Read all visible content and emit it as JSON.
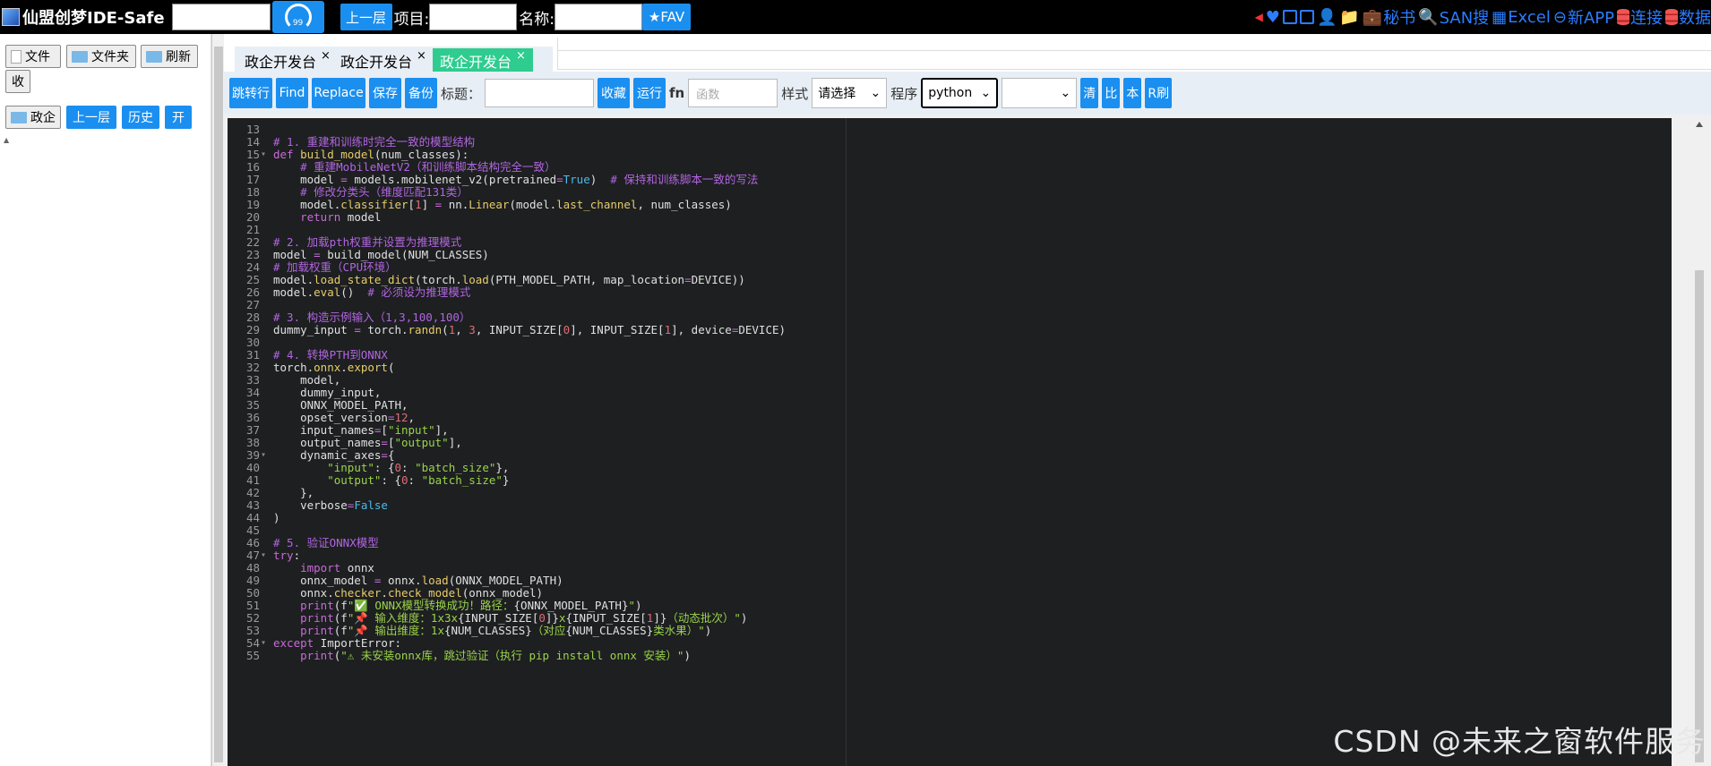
{
  "topbar": {
    "app_title": "仙盟创梦IDE-Safe",
    "up_label": "上一层",
    "project_label": "项目:",
    "name_label": "名称:",
    "fav_label": "★FAV",
    "gauge_value": "99",
    "right_menu": {
      "secret_book": "秘书",
      "san_search": "SAN搜",
      "excel": "Excel",
      "new_app": "新APP",
      "connect": "连接",
      "data": "数据"
    }
  },
  "left": {
    "file_btn": "文件",
    "folder_btn": "文件夹",
    "refresh_btn": "刷新",
    "collapse_btn": "收",
    "gov_btn": "政企",
    "up_btn": "上一层",
    "history_btn": "历史",
    "open_btn": "开"
  },
  "tabs": [
    {
      "label": "政企开发台",
      "active": false
    },
    {
      "label": "政企开发台",
      "active": false
    },
    {
      "label": "政企开发台",
      "active": true
    }
  ],
  "toolbar": {
    "goto_line": "跳转行",
    "find": "Find",
    "replace": "Replace",
    "save": "保存",
    "backup": "备份",
    "title_label": "标题：",
    "favorite": "收藏",
    "run": "运行",
    "fn_label": "fn",
    "fn_placeholder": "函数",
    "style_label": "样式",
    "style_select": "请选择",
    "program_label": "程序",
    "program_select": "python",
    "clear": "清",
    "compare": "比",
    "local": "本",
    "r_refresh": "R刷"
  },
  "editor": {
    "lines": [
      {
        "n": "13",
        "fold": false,
        "html": ""
      },
      {
        "n": "14",
        "fold": false,
        "html": "<span class='c'># 1. 重建和训练时完全一致的模型结构</span>"
      },
      {
        "n": "15",
        "fold": true,
        "html": "<span class='k'>def</span> <span class='fn'>build_model</span>(num_classes):"
      },
      {
        "n": "16",
        "fold": false,
        "html": "    <span class='c'># 重建MobileNetV2（和训练脚本结构完全一致）</span>"
      },
      {
        "n": "17",
        "fold": false,
        "html": "    model <span class='op'>=</span> models.mobilenet_v2(pretrained<span class='op'>=</span><span class='b'>True</span>)  <span class='c'># 保持和训练脚本一致的写法</span>"
      },
      {
        "n": "18",
        "fold": false,
        "html": "    <span class='c'># 修改分类头（维度匹配131类）</span>"
      },
      {
        "n": "19",
        "fold": false,
        "html": "    model.<span class='fn'>classifier</span>[<span class='n'>1</span>] <span class='op'>=</span> nn.<span class='fn'>Linear</span>(model.<span class='fn'>last_channel</span>, num_classes)"
      },
      {
        "n": "20",
        "fold": false,
        "html": "    <span class='k'>return</span> model"
      },
      {
        "n": "21",
        "fold": false,
        "html": ""
      },
      {
        "n": "22",
        "fold": false,
        "html": "<span class='c'># 2. 加载pth权重并设置为推理模式</span>"
      },
      {
        "n": "23",
        "fold": false,
        "html": "model <span class='op'>=</span> build_model(NUM_CLASSES)"
      },
      {
        "n": "24",
        "fold": false,
        "html": "<span class='c'># 加载权重（CPU环境）</span>"
      },
      {
        "n": "25",
        "fold": false,
        "html": "model.<span class='fn'>load_state_dict</span>(torch.<span class='fn'>load</span>(PTH_MODEL_PATH, map_location<span class='op'>=</span>DEVICE))"
      },
      {
        "n": "26",
        "fold": false,
        "html": "model.<span class='fn'>eval</span>()  <span class='c'># 必须设为推理模式</span>"
      },
      {
        "n": "27",
        "fold": false,
        "html": ""
      },
      {
        "n": "28",
        "fold": false,
        "html": "<span class='c'># 3. 构造示例输入（1,3,100,100）</span>"
      },
      {
        "n": "29",
        "fold": false,
        "html": "dummy_input <span class='op'>=</span> torch.<span class='fn'>randn</span>(<span class='n'>1</span>, <span class='n'>3</span>, INPUT_SIZE[<span class='n'>0</span>], INPUT_SIZE[<span class='n'>1</span>], device<span class='op'>=</span>DEVICE)"
      },
      {
        "n": "30",
        "fold": false,
        "html": ""
      },
      {
        "n": "31",
        "fold": false,
        "html": "<span class='c'># 4. 转换PTH到ONNX</span>"
      },
      {
        "n": "32",
        "fold": false,
        "html": "torch.<span class='fn'>onnx</span>.<span class='fn'>export</span>("
      },
      {
        "n": "33",
        "fold": false,
        "html": "    model,"
      },
      {
        "n": "34",
        "fold": false,
        "html": "    dummy_input,"
      },
      {
        "n": "35",
        "fold": false,
        "html": "    ONNX_MODEL_PATH,"
      },
      {
        "n": "36",
        "fold": false,
        "html": "    opset_version<span class='op'>=</span><span class='n'>12</span>,"
      },
      {
        "n": "37",
        "fold": false,
        "html": "    input_names<span class='op'>=</span>[<span class='s'>\"input\"</span>],"
      },
      {
        "n": "38",
        "fold": false,
        "html": "    output_names<span class='op'>=</span>[<span class='s'>\"output\"</span>],"
      },
      {
        "n": "39",
        "fold": true,
        "html": "    dynamic_axes<span class='op'>=</span>{"
      },
      {
        "n": "40",
        "fold": false,
        "html": "        <span class='s'>\"input\"</span>: {<span class='n'>0</span>: <span class='s'>\"batch_size\"</span>},"
      },
      {
        "n": "41",
        "fold": false,
        "html": "        <span class='s'>\"output\"</span>: {<span class='n'>0</span>: <span class='s'>\"batch_size\"</span>}"
      },
      {
        "n": "42",
        "fold": false,
        "html": "    },"
      },
      {
        "n": "43",
        "fold": false,
        "html": "    verbose<span class='op'>=</span><span class='b'>False</span>"
      },
      {
        "n": "44",
        "fold": false,
        "html": ")"
      },
      {
        "n": "45",
        "fold": false,
        "html": ""
      },
      {
        "n": "46",
        "fold": false,
        "html": "<span class='c'># 5. 验证ONNX模型</span>"
      },
      {
        "n": "47",
        "fold": true,
        "html": "<span class='k'>try</span>:"
      },
      {
        "n": "48",
        "fold": false,
        "html": "    <span class='k'>import</span> onnx"
      },
      {
        "n": "49",
        "fold": false,
        "html": "    onnx_model <span class='op'>=</span> onnx.<span class='fn'>load</span>(ONNX_MODEL_PATH)"
      },
      {
        "n": "50",
        "fold": false,
        "html": "    onnx.<span class='fn'>checker</span>.<span class='fn'>check_model</span>(onnx_model)"
      },
      {
        "n": "51",
        "fold": false,
        "html": "    <span class='k'>print</span>(f<span class='s'>\"✅ ONNX模型转换成功！路径：</span>{ONNX_MODEL_PATH}<span class='s'>\"</span>)"
      },
      {
        "n": "52",
        "fold": false,
        "html": "    <span class='k'>print</span>(f<span class='s'>\"📌 输入维度：1x3x</span>{INPUT_SIZE[<span class='n'>0</span>]}<span class='s'>x</span>{INPUT_SIZE[<span class='n'>1</span>]}<span class='s'>（动态批次）\"</span>)"
      },
      {
        "n": "53",
        "fold": false,
        "html": "    <span class='k'>print</span>(f<span class='s'>\"📌 输出维度：1x</span>{NUM_CLASSES}<span class='s'>（对应</span>{NUM_CLASSES}<span class='s'>类水果）\"</span>)"
      },
      {
        "n": "54",
        "fold": true,
        "html": "<span class='k'>except</span> ImportError:"
      },
      {
        "n": "55",
        "fold": false,
        "html": "    <span class='k'>print</span>(<span class='s'>\"⚠ 未安装onnx库，跳过验证（执行 pip install onnx 安装）\"</span>)"
      }
    ]
  },
  "watermark": "CSDN @未来之窗软件服务",
  "colors": {
    "accent": "#1a8ff0",
    "active_tab": "#2ecc8f",
    "editor_bg": "#1d1f21"
  }
}
